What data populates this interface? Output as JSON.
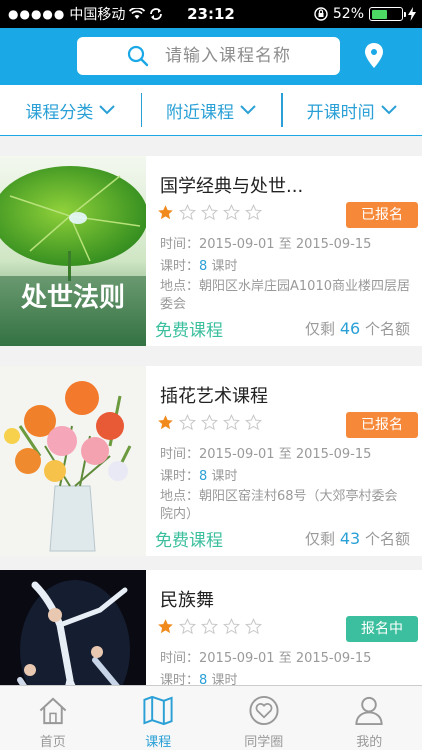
{
  "status": {
    "carrier": "中国移动",
    "time": "23:12",
    "battery": "52%",
    "battery_level": 0.52
  },
  "search": {
    "placeholder": "请输入课程名称"
  },
  "filters": [
    {
      "label": "课程分类"
    },
    {
      "label": "附近课程"
    },
    {
      "label": "开课时间"
    }
  ],
  "courses": [
    {
      "title": "国学经典与处世...",
      "rating": 1,
      "button": "已报名",
      "button_color": "#f6883a",
      "time_label": "时间：",
      "time": "2015-09-01 至 2015-09-15",
      "hours_label": "课时：",
      "hours": "8",
      "hours_unit": "课时",
      "address_label": "地点：",
      "address": "朝阳区水岸庄园A1010商业楼四层居委会",
      "price": "免费课程",
      "remain_prefix": "仅剩",
      "remain": "46",
      "remain_suffix": "个名额",
      "image_text": "处世法则"
    },
    {
      "title": "插花艺术课程",
      "rating": 1,
      "button": "已报名",
      "button_color": "#f6883a",
      "time_label": "时间：",
      "time": "2015-09-01 至 2015-09-15",
      "hours_label": "课时：",
      "hours": "8",
      "hours_unit": "课时",
      "address_label": "地点：",
      "address": "朝阳区窑洼村68号（大郊亭村委会院内）",
      "price": "免费课程",
      "remain_prefix": "仅剩",
      "remain": "43",
      "remain_suffix": "个名额"
    },
    {
      "title": "民族舞",
      "rating": 1,
      "button": "报名中",
      "button_color": "#3cbf9e",
      "time_label": "时间：",
      "time": "2015-09-01 至 2015-09-15",
      "hours_label": "课时：",
      "hours": "8",
      "hours_unit": "课时"
    }
  ],
  "tabs": [
    {
      "label": "首页",
      "icon": "home-icon"
    },
    {
      "label": "课程",
      "icon": "map-icon",
      "active": true
    },
    {
      "label": "同学圈",
      "icon": "heart-icon"
    },
    {
      "label": "我的",
      "icon": "person-icon"
    }
  ]
}
